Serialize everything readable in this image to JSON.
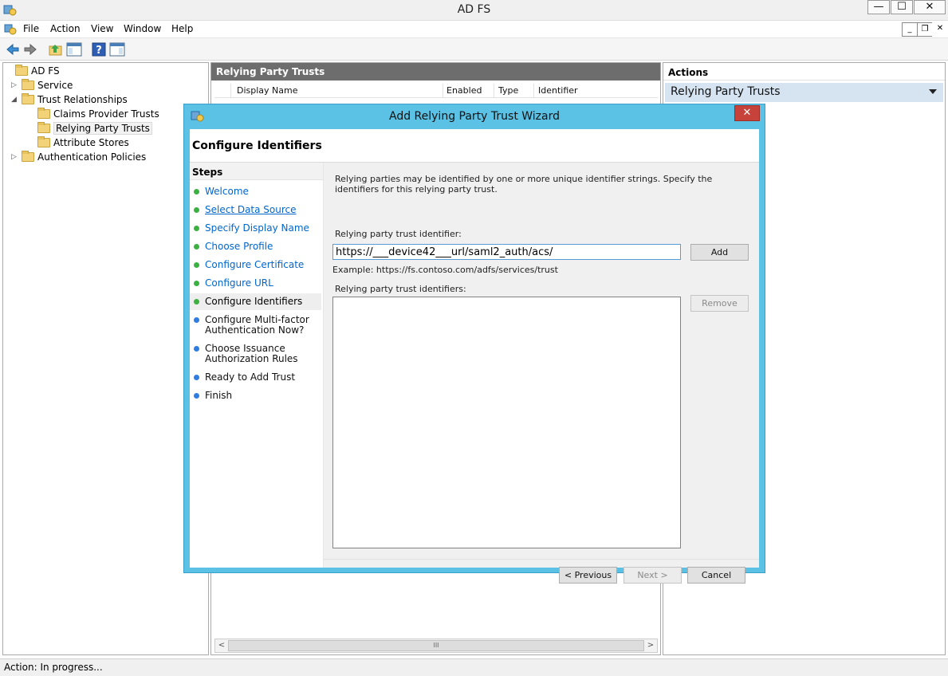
{
  "window": {
    "title": "AD FS",
    "controls": {
      "minimize": "—",
      "maximize": "☐",
      "close": "✕"
    }
  },
  "menu": {
    "items": [
      "File",
      "Action",
      "View",
      "Window",
      "Help"
    ],
    "child_controls": {
      "minimize": "_",
      "restore": "❐",
      "close": "✕"
    }
  },
  "tree": {
    "items": [
      {
        "label": "AD FS",
        "expander": ""
      },
      {
        "label": "Service",
        "expander": "▷"
      },
      {
        "label": "Trust Relationships",
        "expander": "◢"
      },
      {
        "label": "Claims Provider Trusts",
        "expander": ""
      },
      {
        "label": "Relying Party Trusts",
        "expander": ""
      },
      {
        "label": "Attribute Stores",
        "expander": ""
      },
      {
        "label": "Authentication Policies",
        "expander": "▷"
      }
    ]
  },
  "middle": {
    "header": "Relying Party Trusts",
    "columns": [
      "Display Name",
      "Enabled",
      "Type",
      "Identifier"
    ],
    "scroll": {
      "left": "<",
      "right": ">",
      "grip": "III"
    }
  },
  "actions": {
    "header": "Actions",
    "section": "Relying Party Trusts"
  },
  "status": "Action:  In progress...",
  "wizard": {
    "title": "Add Relying Party Trust Wizard",
    "close": "✕",
    "heading": "Configure Identifiers",
    "steps_header": "Steps",
    "steps": [
      {
        "label": "Welcome",
        "state": "done"
      },
      {
        "label": "Select Data Source",
        "state": "done"
      },
      {
        "label": "Specify Display Name",
        "state": "done"
      },
      {
        "label": "Choose Profile",
        "state": "done"
      },
      {
        "label": "Configure Certificate",
        "state": "done"
      },
      {
        "label": "Configure URL",
        "state": "done"
      },
      {
        "label": "Configure Identifiers",
        "state": "current"
      },
      {
        "label": "Configure Multi-factor Authentication Now?",
        "state": "future"
      },
      {
        "label": "Choose Issuance Authorization Rules",
        "state": "future"
      },
      {
        "label": "Ready to Add Trust",
        "state": "future"
      },
      {
        "label": "Finish",
        "state": "future"
      }
    ],
    "description": "Relying parties may be identified by one or more unique identifier strings. Specify the identifiers for this relying party trust.",
    "identifier_label": "Relying party trust identifier:",
    "identifier_value": "https://___device42___url/saml2_auth/acs/",
    "example": "Example: https://fs.contoso.com/adfs/services/trust",
    "identifiers_list_label": "Relying party trust identifiers:",
    "add_button": "Add",
    "remove_button": "Remove",
    "previous_button": "< Previous",
    "next_button": "Next >",
    "cancel_button": "Cancel"
  },
  "colors": {
    "dialog_frame": "#5bc2e6",
    "done_dot": "#3cb043",
    "future_dot": "#2f7de1",
    "link": "#0066cc",
    "close_red": "#c6423a"
  }
}
